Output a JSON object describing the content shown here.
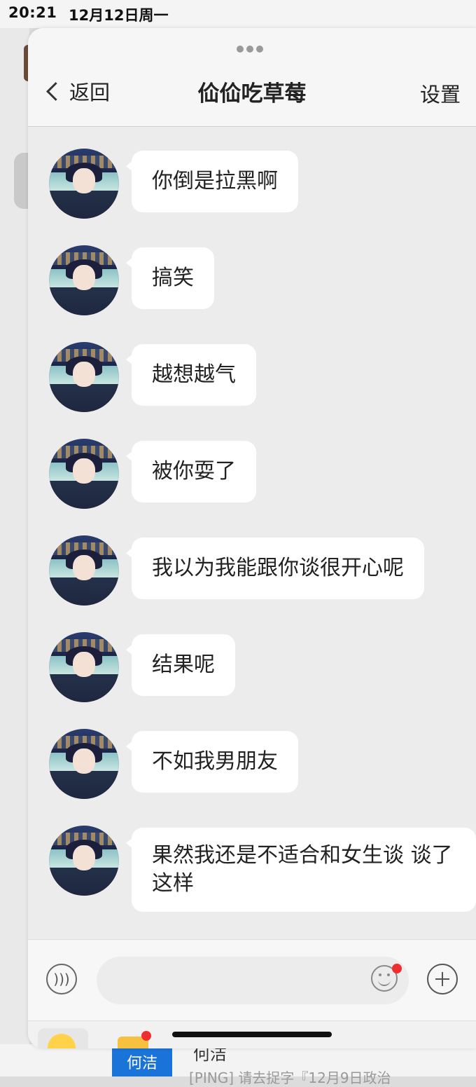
{
  "status_bar": {
    "time": "20:21",
    "date": "12月12日周一"
  },
  "header": {
    "back_label": "返回",
    "title": "佡佡吃草莓",
    "settings_label": "设置"
  },
  "messages": [
    {
      "text": "你倒是拉黑啊"
    },
    {
      "text": "搞笑"
    },
    {
      "text": "越想越气"
    },
    {
      "text": "被你耍了"
    },
    {
      "text": "我以为我能跟你谈很开心呢"
    },
    {
      "text": "结果呢"
    },
    {
      "text": "不如我男朋友"
    },
    {
      "text": "果然我还是不适合和女生谈 谈了这样"
    }
  ],
  "input_bar": {
    "placeholder": ""
  },
  "background": {
    "tag": "何洁",
    "name": "何洁",
    "preview": "[PING] 请去捉字『12月9日政治"
  },
  "icons": [
    "chevron-left-icon",
    "voice-icon",
    "emoji-icon",
    "plus-icon"
  ],
  "colors": {
    "bubble": "#ffffff",
    "chat_bg": "#ececec",
    "badge": "#ef2f2f",
    "tag": "#1a73d9"
  }
}
